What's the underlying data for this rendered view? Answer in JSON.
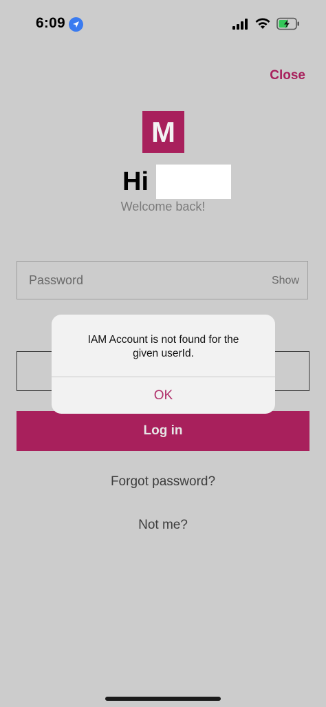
{
  "status_bar": {
    "time": "6:09",
    "icons": [
      "location-arrow-icon",
      "cellular-signal-icon",
      "wifi-icon",
      "battery-charging-icon"
    ]
  },
  "header": {
    "close_label": "Close"
  },
  "logo": {
    "letter": "M"
  },
  "greeting": {
    "hi": "Hi",
    "welcome": "Welcome back!"
  },
  "password": {
    "placeholder": "Password",
    "show_label": "Show"
  },
  "login": {
    "button_label": "Log in",
    "forgot_label": "Forgot password?",
    "not_me_label": "Not me?"
  },
  "alert": {
    "line1": "IAM Account is not found for the",
    "line2": "given userId.",
    "ok_label": "OK"
  },
  "colors": {
    "brand": "#a8205c",
    "background": "#cccccc",
    "alert_bg": "#f2f2f2"
  }
}
